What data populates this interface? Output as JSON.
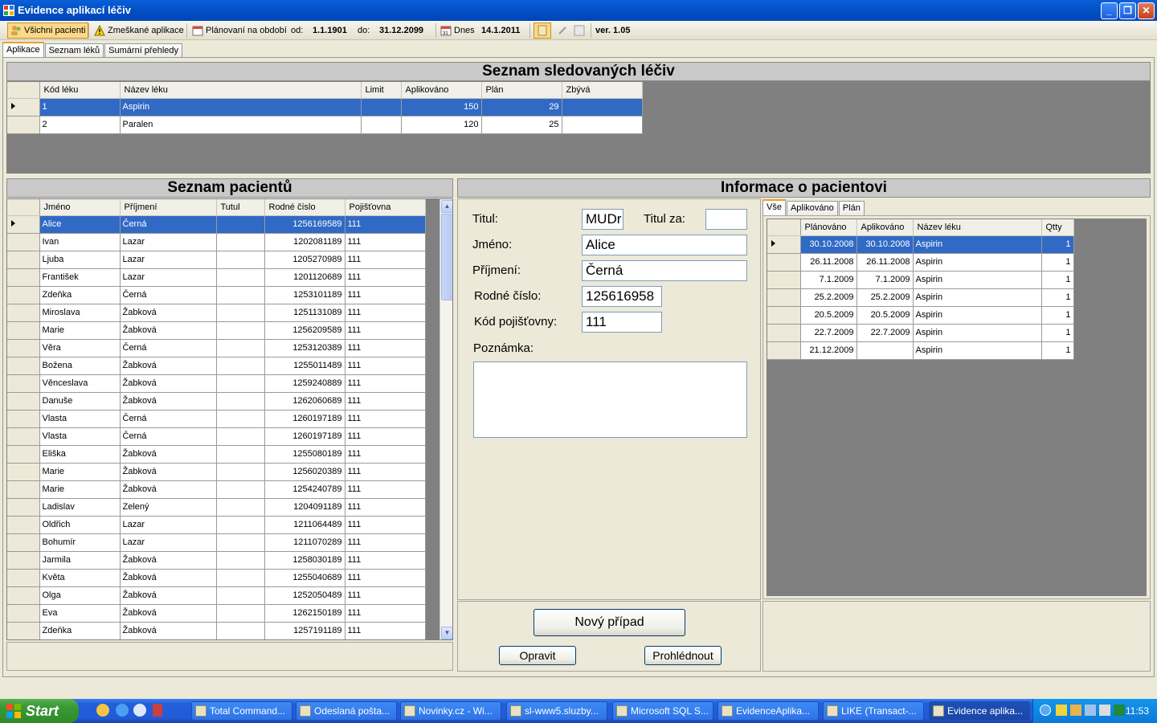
{
  "window": {
    "title": "Evidence aplikací léčiv"
  },
  "toolbar": {
    "all_patients": "Všichni pacienti",
    "missed": "Zmeškané aplikace",
    "planned": "Plánovaní na období",
    "from_label": "od:",
    "from_value": "1.1.1901",
    "to_label": "do:",
    "to_value": "31.12.2099",
    "today_label": "Dnes",
    "today_value": "14.1.2011",
    "version": "ver. 1.05"
  },
  "tabs": [
    "Aplikace",
    "Seznam léků",
    "Sumární přehledy"
  ],
  "drugs": {
    "title": "Seznam sledovaných léčiv",
    "columns": [
      "Kód léku",
      "Název léku",
      "Limit",
      "Aplikováno",
      "Plán",
      "Zbývá"
    ],
    "rows": [
      {
        "code": "1",
        "name": "Aspirin",
        "limit": "",
        "applied": "150",
        "plan": "29",
        "left": ""
      },
      {
        "code": "2",
        "name": "Paralen",
        "limit": "",
        "applied": "120",
        "plan": "25",
        "left": ""
      }
    ]
  },
  "patients": {
    "title": "Seznam pacientů",
    "columns": [
      "Jméno",
      "Příjmení",
      "Tutul",
      "Rodné číslo",
      "Pojišťovna"
    ],
    "rows": [
      [
        "Alice",
        "Černá",
        "",
        "1256169589",
        "111"
      ],
      [
        "Ivan",
        "Lazar",
        "",
        "1202081189",
        "111"
      ],
      [
        "Ljuba",
        "Lazar",
        "",
        "1205270989",
        "111"
      ],
      [
        "František",
        "Lazar",
        "",
        "1201120689",
        "111"
      ],
      [
        "Zdeňka",
        "Černá",
        "",
        "1253101189",
        "111"
      ],
      [
        "Miroslava",
        "Žabková",
        "",
        "1251131089",
        "111"
      ],
      [
        "Marie",
        "Žabková",
        "",
        "1256209589",
        "111"
      ],
      [
        "Věra",
        "Černá",
        "",
        "1253120389",
        "111"
      ],
      [
        "Božena",
        "Žabková",
        "",
        "1255011489",
        "111"
      ],
      [
        "Věnceslava",
        "Žabková",
        "",
        "1259240889",
        "111"
      ],
      [
        "Danuše",
        "Žabková",
        "",
        "1262060689",
        "111"
      ],
      [
        "Vlasta",
        "Černá",
        "",
        "1260197189",
        "111"
      ],
      [
        "Vlasta",
        "Černá",
        "",
        "1260197189",
        "111"
      ],
      [
        "Eliška",
        "Žabková",
        "",
        "1255080189",
        "111"
      ],
      [
        "Marie",
        "Žabková",
        "",
        "1256020389",
        "111"
      ],
      [
        "Marie",
        "Žabková",
        "",
        "1254240789",
        "111"
      ],
      [
        "Ladislav",
        "Zelený",
        "",
        "1204091189",
        "111"
      ],
      [
        "Oldřich",
        "Lazar",
        "",
        "1211064489",
        "111"
      ],
      [
        "Bohumír",
        "Lazar",
        "",
        "1211070289",
        "111"
      ],
      [
        "Jarmila",
        "Žabková",
        "",
        "1258030189",
        "111"
      ],
      [
        "Květa",
        "Žabková",
        "",
        "1255040689",
        "111"
      ],
      [
        "Olga",
        "Žabková",
        "",
        "1252050489",
        "111"
      ],
      [
        "Eva",
        "Žabková",
        "",
        "1262150189",
        "111"
      ],
      [
        "Zdeňka",
        "Žabková",
        "",
        "1257191189",
        "111"
      ]
    ]
  },
  "info": {
    "title": "Informace o pacientovi",
    "titul_label": "Titul:",
    "titul_value": "MUDr",
    "titul_za_label": "Titul za:",
    "titul_za_value": "",
    "jmeno_label": "Jméno:",
    "jmeno_value": "Alice",
    "prijmeni_label": "Příjmení:",
    "prijmeni_value": "Černá",
    "rc_label": "Rodné číslo:",
    "rc_value": "125616958",
    "kp_label": "Kód pojišťovny:",
    "kp_value": "111",
    "note_label": "Poznámka:",
    "note_value": "",
    "new_case": "Nový případ",
    "edit": "Opravit",
    "view": "Prohlédnout"
  },
  "apps": {
    "tabs": [
      "Vše",
      "Aplikováno",
      "Plán"
    ],
    "columns": [
      "Plánováno",
      "Aplikováno",
      "Název léku",
      "Qtty"
    ],
    "rows": [
      [
        "30.10.2008",
        "30.10.2008",
        "Aspirin",
        "1"
      ],
      [
        "26.11.2008",
        "26.11.2008",
        "Aspirin",
        "1"
      ],
      [
        "7.1.2009",
        "7.1.2009",
        "Aspirin",
        "1"
      ],
      [
        "25.2.2009",
        "25.2.2009",
        "Aspirin",
        "1"
      ],
      [
        "20.5.2009",
        "20.5.2009",
        "Aspirin",
        "1"
      ],
      [
        "22.7.2009",
        "22.7.2009",
        "Aspirin",
        "1"
      ],
      [
        "21.12.2009",
        "",
        "Aspirin",
        "1"
      ]
    ]
  },
  "taskbar": {
    "start": "Start",
    "tasks": [
      "Total Command...",
      "Odeslaná pošta...",
      "Novinky.cz - Wi...",
      "sl-www5.sluzby...",
      "Microsoft SQL S...",
      "EvidenceAplika...",
      "LIKE (Transact-...",
      "Evidence aplika..."
    ],
    "clock": "11:53"
  },
  "colors": {
    "selection": "#316ac5",
    "titlebar": "#0352c8",
    "grid_bg": "#808080"
  }
}
